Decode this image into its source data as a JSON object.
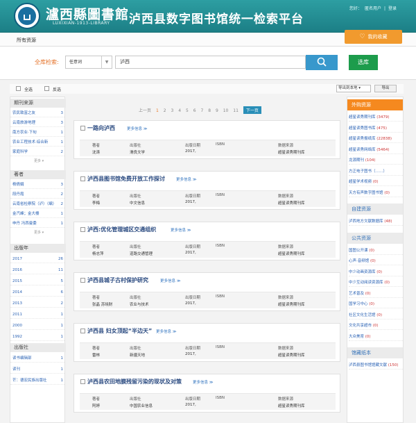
{
  "header": {
    "library_name": "瀘西縣圖書館",
    "library_en": "LUXIXIAN-1913-LIBRARY",
    "platform_title": "泸西县数字图书馆统一检索平台",
    "greeting": "您好：",
    "user": "匿名用户",
    "separator": "|",
    "logout": "登录"
  },
  "nav": {
    "all_resources": "所有资源",
    "favorites": "我的收藏"
  },
  "search": {
    "label": "全库检索:",
    "field": "任意词",
    "query": "泸西",
    "button_icon": "search-icon",
    "select_lib": "选库"
  },
  "toolbar": {
    "select_all": "全选",
    "invert": "反选",
    "export_format": "导出到本地",
    "export": "导出"
  },
  "left": {
    "sections": [
      {
        "title": "期刊来源",
        "items": [
          {
            "label": "农民致富之友",
            "count": "3"
          },
          {
            "label": "云南旅游地理",
            "count": "3"
          },
          {
            "label": "南方农业·下旬",
            "count": "1"
          },
          {
            "label": "农业工程技术·综合新",
            "count": "1"
          },
          {
            "label": "家庭科学",
            "count": "2"
          }
        ],
        "more": "更多"
      },
      {
        "title": "著者",
        "items": [
          {
            "label": "杨倩娟",
            "count": "3"
          },
          {
            "label": "段丹霞",
            "count": "2"
          },
          {
            "label": "云南省检察院（泸）（编）",
            "count": "2"
          },
          {
            "label": "金汽峰；金大楼",
            "count": "1"
          },
          {
            "label": "申丹 冯西曼委",
            "count": "1"
          }
        ],
        "more": "更多"
      },
      {
        "title": "出版年",
        "items": [
          {
            "label": "2017",
            "count": "26"
          },
          {
            "label": "2016",
            "count": "11"
          },
          {
            "label": "2015",
            "count": "5"
          },
          {
            "label": "2014",
            "count": "6"
          },
          {
            "label": "2013",
            "count": "2"
          },
          {
            "label": "2011",
            "count": "1"
          },
          {
            "label": "2000",
            "count": "1"
          },
          {
            "label": "1992",
            "count": "1"
          }
        ]
      },
      {
        "title": "出版社",
        "items": [
          {
            "label": "读书编辑部",
            "count": "1"
          },
          {
            "label": "读刊",
            "count": "1"
          },
          {
            "label": "芒：德宏民族出版社",
            "count": "1"
          }
        ]
      }
    ]
  },
  "pager": {
    "prev": "上一页",
    "pages": [
      "1",
      "2",
      "3",
      "4",
      "5",
      "6",
      "7",
      "8",
      "9",
      "10",
      "11"
    ],
    "current": "1",
    "next": "下一页"
  },
  "results": {
    "headers": [
      "著者",
      "出版社",
      "出版日期",
      "ISBN",
      "数据来源"
    ],
    "more_info": "更多信息",
    "items": [
      {
        "title": "一路向泸西",
        "author": "沈涛",
        "publisher": "滑良文学",
        "date": "2017,",
        "isbn": "",
        "source": "超星读秀期刊库"
      },
      {
        "title": "泸西县图书馆免费开放工作探讨",
        "author": "李梅",
        "publisher": "中文信息",
        "date": "2017,",
        "isbn": "",
        "source": "超星读秀期刊库"
      },
      {
        "title": "泸西:优化管理城区交通组织",
        "author": "杨志萍",
        "publisher": "道路交通管理",
        "date": "2017,",
        "isbn": "",
        "source": "超星读秀期刊库"
      },
      {
        "title": "泸西县城子古村保护研究",
        "author": "张晶 苏晓财",
        "publisher": "农业与技术",
        "date": "2017,",
        "isbn": "",
        "source": "超星读秀期刊库"
      },
      {
        "title": "泸西县 妇女顶起“半边天”",
        "author": "雷林",
        "publisher": "新疆天地",
        "date": "2017,",
        "isbn": "",
        "source": "超星读秀期刊库"
      },
      {
        "title": "泸西县农田地膜残留污染的现状及对策",
        "author": "阿婷",
        "publisher": "中国农业信息",
        "date": "2017,",
        "isbn": "",
        "source": "超星读秀期刊库"
      }
    ]
  },
  "right": {
    "sections": [
      {
        "title": "外购资源",
        "items": [
          {
            "label": "超星读秀期刊库",
            "count": "(3479)"
          },
          {
            "label": "超星读秀图书库",
            "count": "(475)"
          },
          {
            "label": "超星读秀报纸库",
            "count": "(22838)"
          },
          {
            "label": "超星读秀网络库",
            "count": "(5464)"
          },
          {
            "label": "龙源期刊",
            "count": "(104)"
          },
          {
            "label": "方正电子图书（……）",
            "count": ""
          },
          {
            "label": "超星学术视频",
            "count": "(0)"
          },
          {
            "label": "天方有声数字图书馆",
            "count": "(0)"
          }
        ]
      },
      {
        "title": "自建资源",
        "items": [
          {
            "label": "泸西地方文献数据库",
            "count": "(48)"
          }
        ]
      },
      {
        "title": "公共资源",
        "items": [
          {
            "label": "国图公开课",
            "count": "(0)"
          },
          {
            "label": "心声·音频馆",
            "count": "(0)"
          },
          {
            "label": "中少动画资源库",
            "count": "(0)"
          },
          {
            "label": "中少互动阅读资源库",
            "count": "(0)"
          },
          {
            "label": "艺术普及",
            "count": "(0)"
          },
          {
            "label": "国学习中心",
            "count": "(0)"
          },
          {
            "label": "社区文化生活馆",
            "count": "(0)"
          },
          {
            "label": "文化共享超市",
            "count": "(0)"
          },
          {
            "label": "大众美育",
            "count": "(0)"
          }
        ]
      },
      {
        "title": "馆藏纸本",
        "items": [
          {
            "label": "泸西县图书馆馆藏文献",
            "count": "(150)"
          }
        ]
      }
    ]
  },
  "colors": {
    "header": "#2d9ea2",
    "accent_orange": "#f19a2e",
    "search_blue": "#3898cc",
    "lib_green": "#1d9c4c",
    "link": "#2a62b4"
  }
}
